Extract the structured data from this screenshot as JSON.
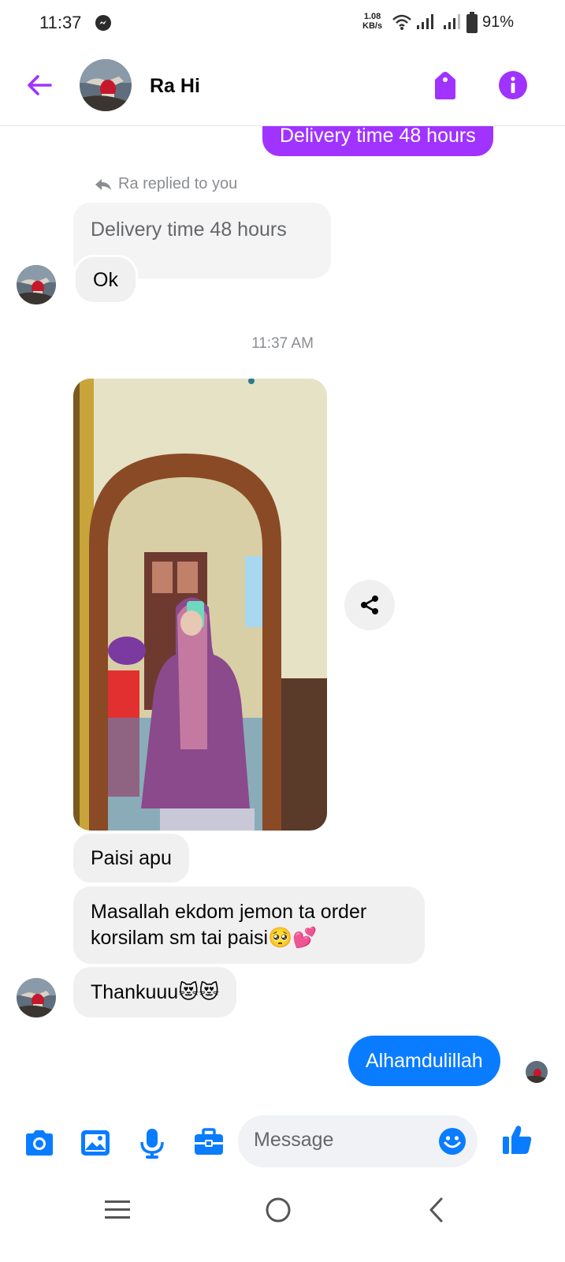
{
  "status_bar": {
    "time": "11:37",
    "speed_value": "1.08",
    "speed_unit": "KB/s",
    "battery": "91%"
  },
  "header": {
    "contact_name": "Ra Hi"
  },
  "messages": {
    "top_outgoing": "Delivery time 48 hours",
    "reply_notice": "Ra replied to you",
    "quoted": "Delivery time 48 hours",
    "reply_ok": "Ok",
    "timestamp": "11:37 AM",
    "paisi_apu": "Paisi apu",
    "masallah_line1": "Masallah ekdom jemon ta order",
    "masallah_line2": "korsilam sm tai paisi🥺💕",
    "thanks": "Thankuuu😻😻",
    "outgoing_last": "Alhamdulillah"
  },
  "composer": {
    "placeholder": "Message"
  },
  "colors": {
    "accent_purple": "#a033ff",
    "messenger_blue": "#0a7cff",
    "incoming_bubble": "#f0f0f0"
  },
  "icons": {
    "header": [
      "back-arrow-icon",
      "tag-icon",
      "info-icon"
    ],
    "composer": [
      "camera-icon",
      "gallery-icon",
      "microphone-icon",
      "briefcase-icon",
      "emoji-icon",
      "thumbs-up-icon"
    ],
    "nav": [
      "recent-apps-icon",
      "home-icon",
      "back-icon"
    ]
  }
}
